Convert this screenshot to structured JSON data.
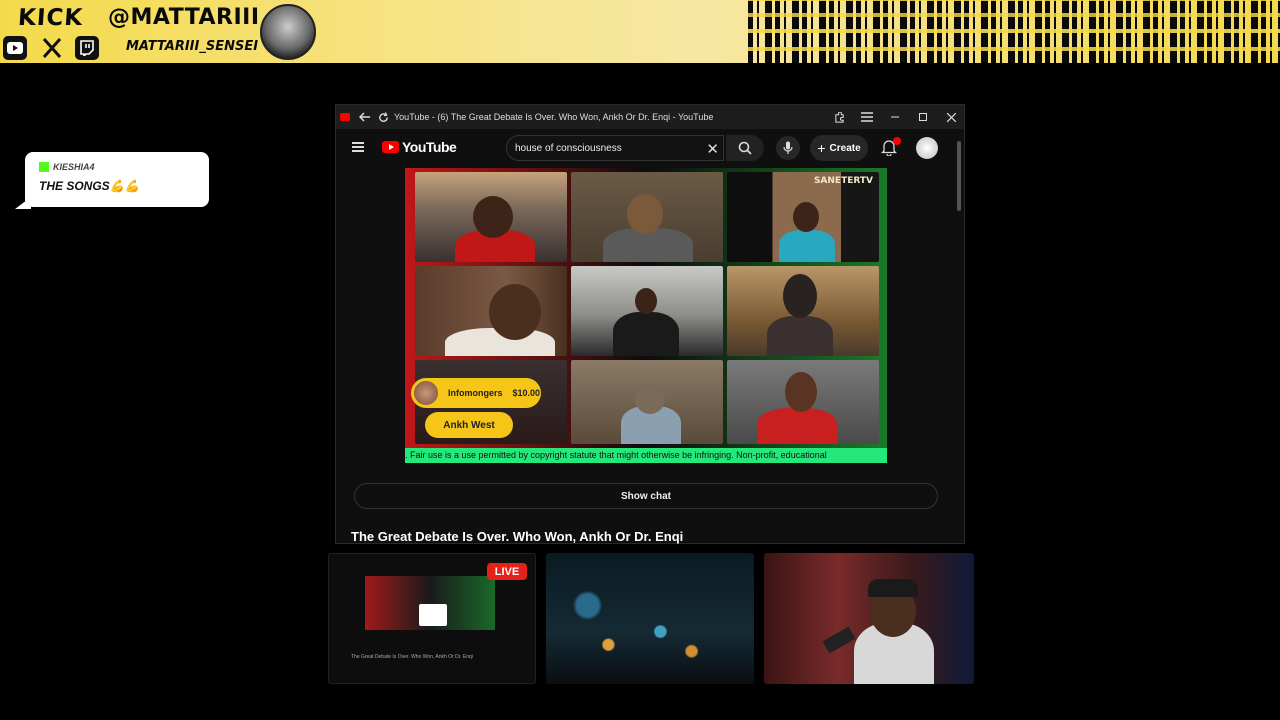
{
  "banner": {
    "platform": "KICK",
    "handle": "@MATTARIII",
    "subhandle": "MATTARIII_SENSEI",
    "socials": [
      "youtube-icon",
      "x-icon",
      "twitch-icon"
    ]
  },
  "chat_overlay": {
    "username": "KIESHIA4",
    "message": "THE SONGS💪💪"
  },
  "browser": {
    "tab_title": "YouTube - (6) The Great Debate Is Over. Who Won, Ankh Or Dr. Enqi - YouTube"
  },
  "youtube": {
    "logo_text": "YouTube",
    "search_value": "house of consciousness",
    "create_label": "Create",
    "notification_count": "6"
  },
  "video": {
    "channel_brand": "SANETERTV",
    "donation_name": "Infomongers",
    "donation_amount": "$10.00",
    "donation_name_2": "Ankh West",
    "ticker_text": ". Fair use is a use permitted by copyright statute that might otherwise be infringing. Non-profit, educational"
  },
  "below_video": {
    "show_chat_label": "Show chat",
    "video_title": "The Great Debate Is Over. Who Won, Ankh Or Dr. Enqi"
  },
  "thumbnails": {
    "live_badge": "LIVE",
    "mini_title": "The Great Debate Is Over. Who Won, Ankh Or Dr. Enqi"
  },
  "colors": {
    "banner_yellow": "#f4da4a",
    "youtube_red": "#ff0000",
    "ticker_green": "#25e87a",
    "donation_gold": "#f5c518",
    "kick_green": "#53fc18"
  }
}
